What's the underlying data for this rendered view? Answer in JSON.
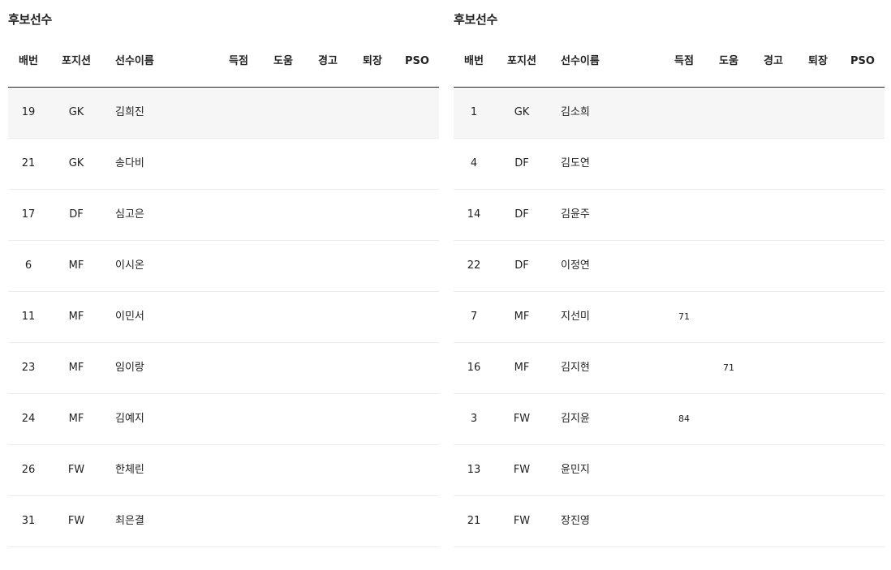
{
  "left": {
    "title": "후보선수",
    "headers": {
      "number": "배번",
      "position": "포지션",
      "name": "선수이름",
      "goals": "득점",
      "assists": "도움",
      "warnings": "경고",
      "sentoff": "퇴장",
      "pso": "PSO"
    },
    "rows": [
      {
        "number": "19",
        "position": "GK",
        "name": "김희진",
        "goals": "",
        "assists": ""
      },
      {
        "number": "21",
        "position": "GK",
        "name": "송다비",
        "goals": "",
        "assists": ""
      },
      {
        "number": "17",
        "position": "DF",
        "name": "심고은",
        "goals": "",
        "assists": ""
      },
      {
        "number": "6",
        "position": "MF",
        "name": "이시온",
        "goals": "",
        "assists": ""
      },
      {
        "number": "11",
        "position": "MF",
        "name": "이민서",
        "goals": "",
        "assists": ""
      },
      {
        "number": "23",
        "position": "MF",
        "name": "임이랑",
        "goals": "",
        "assists": ""
      },
      {
        "number": "24",
        "position": "MF",
        "name": "김예지",
        "goals": "",
        "assists": ""
      },
      {
        "number": "26",
        "position": "FW",
        "name": "한체린",
        "goals": "",
        "assists": ""
      },
      {
        "number": "31",
        "position": "FW",
        "name": "최은결",
        "goals": "",
        "assists": ""
      }
    ]
  },
  "right": {
    "title": "후보선수",
    "headers": {
      "number": "배번",
      "position": "포지션",
      "name": "선수이름",
      "goals": "득점",
      "assists": "도움",
      "warnings": "경고",
      "sentoff": "퇴장",
      "pso": "PSO"
    },
    "rows": [
      {
        "number": "1",
        "position": "GK",
        "name": "김소희",
        "goals": "",
        "assists": ""
      },
      {
        "number": "4",
        "position": "DF",
        "name": "김도연",
        "goals": "",
        "assists": ""
      },
      {
        "number": "14",
        "position": "DF",
        "name": "김윤주",
        "goals": "",
        "assists": ""
      },
      {
        "number": "22",
        "position": "DF",
        "name": "이정연",
        "goals": "",
        "assists": ""
      },
      {
        "number": "7",
        "position": "MF",
        "name": "지선미",
        "goals": "71",
        "assists": ""
      },
      {
        "number": "16",
        "position": "MF",
        "name": "김지현",
        "goals": "",
        "assists": "71"
      },
      {
        "number": "3",
        "position": "FW",
        "name": "김지윤",
        "goals": "84",
        "assists": ""
      },
      {
        "number": "13",
        "position": "FW",
        "name": "윤민지",
        "goals": "",
        "assists": ""
      },
      {
        "number": "21",
        "position": "FW",
        "name": "장진영",
        "goals": "",
        "assists": ""
      }
    ]
  }
}
